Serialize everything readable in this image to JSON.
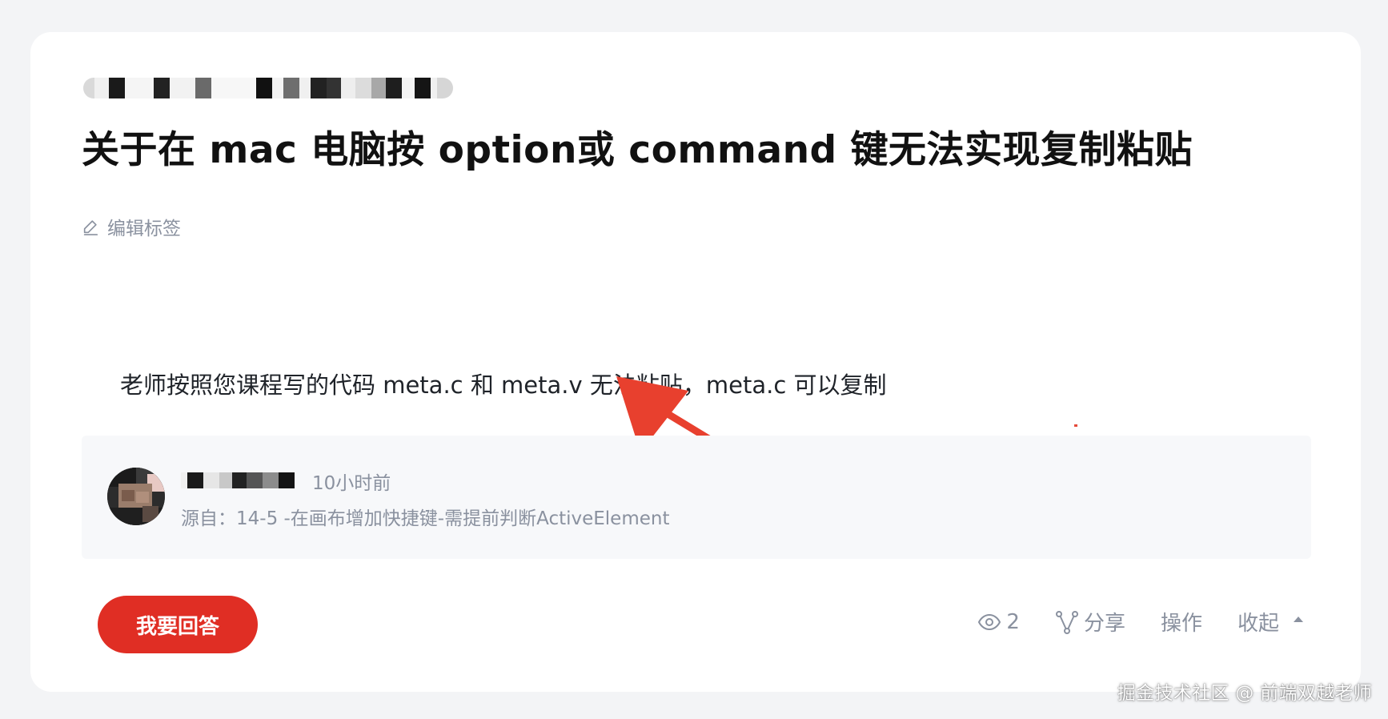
{
  "question": {
    "title": "关于在 mac 电脑按 option或 command 键无法实现复制粘贴",
    "edit_tags_label": "编辑标签",
    "body": "老师按照您课程写的代码 meta.c 和 meta.v 无法粘贴，meta.c 可以复制"
  },
  "author": {
    "time_ago": "10小时前",
    "source": "源自：14-5  -在画布增加快捷键-需提前判断ActiveElement"
  },
  "footer": {
    "answer_button_label": "我要回答",
    "view_count": "2",
    "share_label": "分享",
    "operate_label": "操作",
    "collapse_label": "收起"
  },
  "watermark": "掘金技术社区 @ 前端双越老师",
  "icons": {
    "edit": "pencil-icon",
    "views": "eye-icon",
    "share": "share-icon",
    "collapse": "caret-up-icon"
  },
  "colors": {
    "accent": "#e02e24",
    "muted_text": "#8a919f",
    "card_bg": "#ffffff",
    "page_bg": "#f3f4f6",
    "source_bg": "#f7f8fa"
  }
}
